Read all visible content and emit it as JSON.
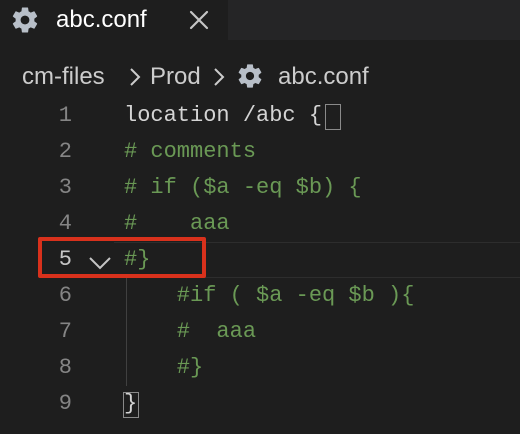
{
  "tab": {
    "label": "abc.conf",
    "icon": "gear-icon",
    "close_icon": "close-icon"
  },
  "breadcrumb": {
    "items": [
      "cm-files",
      "Prod",
      "abc.conf"
    ],
    "separator_icon": "chevron-right-icon",
    "file_icon": "gear-icon"
  },
  "editor": {
    "active_line": 5,
    "lines": [
      {
        "num": "1",
        "text": "location /abc {",
        "kind": "code"
      },
      {
        "num": "2",
        "text": "# comments",
        "kind": "comment"
      },
      {
        "num": "3",
        "text": "# if ($a -eq $b) {",
        "kind": "comment"
      },
      {
        "num": "4",
        "text": "#    aaa",
        "kind": "comment"
      },
      {
        "num": "5",
        "text": "#}",
        "kind": "comment"
      },
      {
        "num": "6",
        "text": "    #if ( $a -eq $b ){",
        "kind": "comment"
      },
      {
        "num": "7",
        "text": "    #  aaa",
        "kind": "comment"
      },
      {
        "num": "8",
        "text": "    #}",
        "kind": "comment"
      },
      {
        "num": "9",
        "text": "}",
        "kind": "code"
      }
    ],
    "fold_icon": "chevron-down-icon"
  },
  "colors": {
    "background": "#1e1e1e",
    "tab_inactive_bg": "#252526",
    "comment": "#6a9955",
    "code": "#d4d4d4",
    "line_number": "#858585",
    "highlight_border": "#d8311c"
  }
}
